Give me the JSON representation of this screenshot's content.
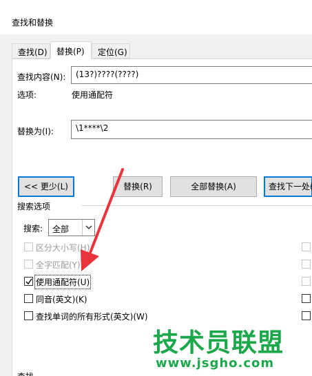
{
  "window": {
    "title": "查找和替换"
  },
  "tabs": [
    {
      "label": "查找(D)",
      "active": false
    },
    {
      "label": "替换(P)",
      "active": true
    },
    {
      "label": "定位(G)",
      "active": false
    }
  ],
  "find": {
    "label": "查找内容(N):",
    "value": "(13?)????(????)"
  },
  "options_row": {
    "label": "选项:",
    "value": "使用通配符"
  },
  "replace": {
    "label": "替换为(I):",
    "value": "\\1****\\2"
  },
  "buttons": {
    "less": "<< 更少(L)",
    "replace": "替换(R)",
    "replace_all": "全部替换(A)",
    "find_next": "查找下一处(F)"
  },
  "search_options": {
    "heading": "搜索选项",
    "search_label": "搜索:",
    "search_value": "全部",
    "checkboxes": [
      {
        "label": "区分大小写(H)",
        "checked": false,
        "disabled": true
      },
      {
        "label": "全字匹配(Y)",
        "checked": false,
        "disabled": true
      },
      {
        "label": "使用通配符(U)",
        "checked": true,
        "disabled": false
      },
      {
        "label": "同音(英文)(K)",
        "checked": false,
        "disabled": false
      },
      {
        "label": "查找单词的所有形式(英文)(W)",
        "checked": false,
        "disabled": false
      }
    ]
  },
  "footer": {
    "section_label": "查找"
  },
  "watermark": {
    "brand": "技术员联盟",
    "url": "www.jsgho.com"
  },
  "colors": {
    "accent": "#0078d7",
    "annotation_arrow": "#e8343a",
    "watermark": "#1aa84a"
  }
}
